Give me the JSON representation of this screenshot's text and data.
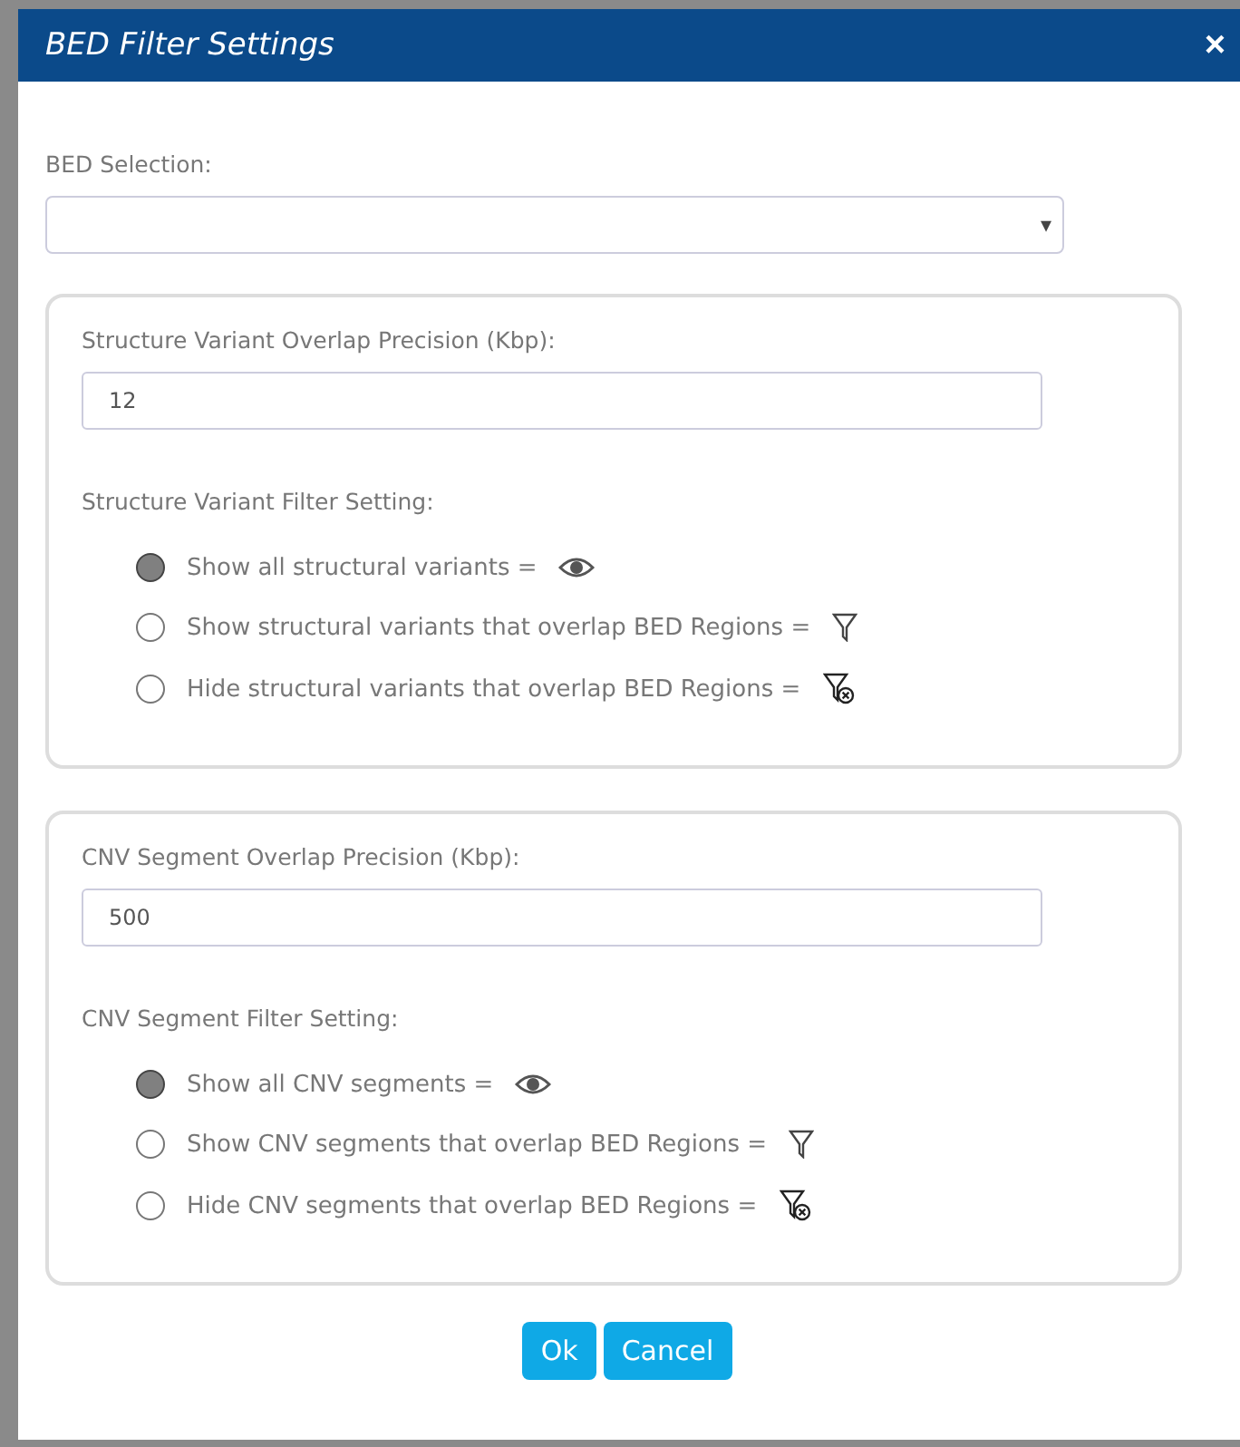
{
  "dialog": {
    "title": "BED Filter Settings",
    "close": "×"
  },
  "bed_selection": {
    "label": "BED Selection:",
    "arrow": "▾"
  },
  "sections": [
    {
      "precision_label": "Structure Variant Overlap Precision (Kbp):",
      "precision_value": "12",
      "filter_label": "Structure Variant Filter Setting:",
      "options": [
        {
          "label": "Show all structural variants =",
          "kind": "eye",
          "selected": true
        },
        {
          "label": "Show structural variants that overlap BED Regions =",
          "kind": "filter",
          "selected": false
        },
        {
          "label": "Hide structural variants that overlap BED Regions =",
          "kind": "filter-off",
          "selected": false
        }
      ]
    },
    {
      "precision_label": "CNV Segment Overlap Precision (Kbp):",
      "precision_value": "500",
      "filter_label": "CNV Segment Filter Setting:",
      "options": [
        {
          "label": "Show all CNV segments =",
          "kind": "eye",
          "selected": true
        },
        {
          "label": "Show CNV segments that overlap BED Regions =",
          "kind": "filter",
          "selected": false
        },
        {
          "label": "Hide CNV segments that overlap BED Regions =",
          "kind": "filter-off",
          "selected": false
        }
      ]
    }
  ],
  "buttons": [
    {
      "label": "Ok"
    },
    {
      "label": "Cancel"
    }
  ]
}
